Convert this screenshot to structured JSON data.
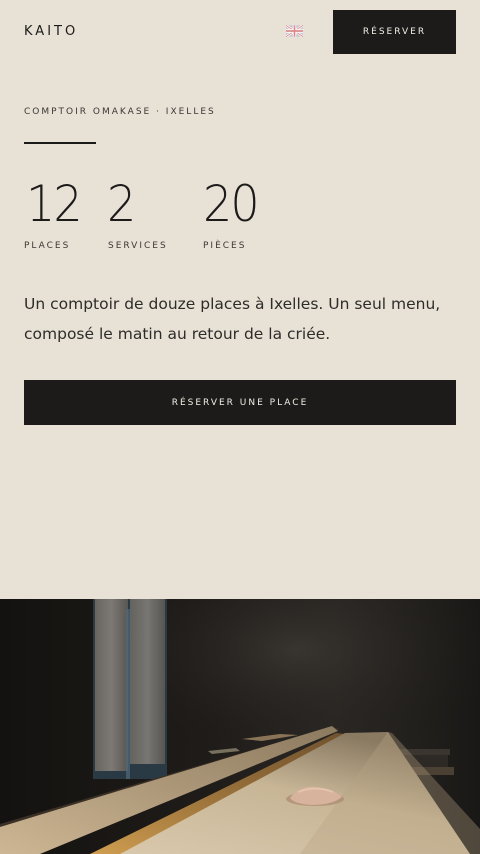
{
  "header": {
    "logo": "KAITO",
    "language_flag": "uk-flag-icon",
    "reserve_label": "RÉSERVER"
  },
  "hero": {
    "eyebrow": "COMPTOIR OMAKASE · IXELLES",
    "stats": [
      {
        "value": "12",
        "label": "PLACES"
      },
      {
        "value": "2",
        "label": "SERVICES"
      },
      {
        "value": "20",
        "label": "PIÈCES"
      }
    ],
    "intro": "Un comptoir de douze places à Ixelles. Un seul menu, composé le matin au retour de la criée.",
    "cta_label": "RÉSERVER UNE PLACE"
  },
  "photo": {
    "subject": "sushi-counter-photo"
  },
  "colors": {
    "background": "#e8e1d6",
    "ink": "#1c1b1a",
    "button_text": "#f2ede5"
  }
}
